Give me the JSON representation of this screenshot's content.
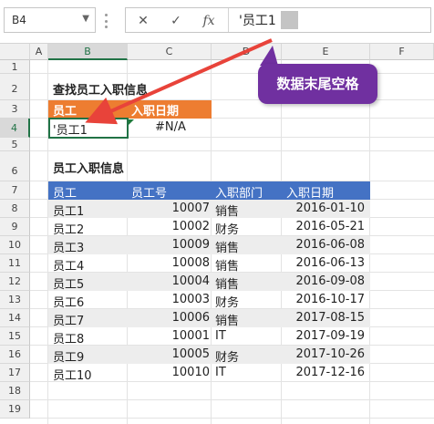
{
  "name_box": "B4",
  "formula_bar": {
    "cancel_label": "✕",
    "enter_label": "✓",
    "fx_label": "fx",
    "value": "'员工1"
  },
  "columns": [
    "A",
    "B",
    "C",
    "D",
    "E",
    "F"
  ],
  "rows": [
    "1",
    "2",
    "3",
    "4",
    "5",
    "6",
    "7",
    "8",
    "9",
    "10",
    "11",
    "12",
    "13",
    "14",
    "15",
    "16",
    "17",
    "18",
    "19"
  ],
  "lookup": {
    "title": "查找员工入职信息",
    "headers": [
      "员工",
      "入职日期"
    ],
    "employee": "'员工1",
    "result": "#N/A"
  },
  "table": {
    "title": "员工入职信息",
    "headers": [
      "员工",
      "员工号",
      "入职部门",
      "入职日期"
    ],
    "rows": [
      [
        "员工1",
        "10007",
        "销售",
        "2016-01-10"
      ],
      [
        "员工2",
        "10002",
        "财务",
        "2016-05-21"
      ],
      [
        "员工3",
        "10009",
        "销售",
        "2016-06-08"
      ],
      [
        "员工4",
        "10008",
        "销售",
        "2016-06-13"
      ],
      [
        "员工5",
        "10004",
        "销售",
        "2016-09-08"
      ],
      [
        "员工6",
        "10003",
        "财务",
        "2016-10-17"
      ],
      [
        "员工7",
        "10006",
        "销售",
        "2017-08-15"
      ],
      [
        "员工8",
        "10001",
        "IT",
        "2017-09-19"
      ],
      [
        "员工9",
        "10005",
        "财务",
        "2017-10-26"
      ],
      [
        "员工10",
        "10010",
        "IT",
        "2017-12-16"
      ]
    ]
  },
  "callout": "数据末尾空格",
  "colors": {
    "orange_header": "#ed7d31",
    "blue_header": "#4472c4",
    "callout": "#7030a0",
    "arrow": "#e8433a",
    "selection": "#217346"
  }
}
